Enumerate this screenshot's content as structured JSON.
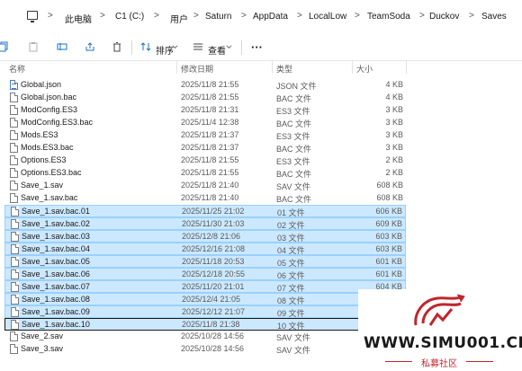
{
  "address": {
    "crumbs": [
      "此电脑",
      "C1 (C:)",
      "用户",
      "Saturn",
      "AppData",
      "LocalLow",
      "TeamSoda",
      "Duckov",
      "Saves"
    ],
    "separator": ">"
  },
  "toolbar": {
    "sort_label": "排序",
    "view_label": "查看",
    "more_label": "···"
  },
  "columns": {
    "name": "名称",
    "modified": "修改日期",
    "type": "类型",
    "size": "大小"
  },
  "files": [
    {
      "name": "Global.json",
      "date": "2025/11/8 21:55",
      "type": "JSON 文件",
      "size": "4 KB",
      "selected": false,
      "icon": "json-file-icon"
    },
    {
      "name": "Global.json.bac",
      "date": "2025/11/8 21:55",
      "type": "BAC 文件",
      "size": "4 KB",
      "selected": false,
      "icon": "file-icon"
    },
    {
      "name": "ModConfig.ES3",
      "date": "2025/11/8 21:31",
      "type": "ES3 文件",
      "size": "3 KB",
      "selected": false,
      "icon": "file-icon"
    },
    {
      "name": "ModConfig.ES3.bac",
      "date": "2025/11/4 12:38",
      "type": "BAC 文件",
      "size": "3 KB",
      "selected": false,
      "icon": "file-icon"
    },
    {
      "name": "Mods.ES3",
      "date": "2025/11/8 21:37",
      "type": "ES3 文件",
      "size": "3 KB",
      "selected": false,
      "icon": "file-icon"
    },
    {
      "name": "Mods.ES3.bac",
      "date": "2025/11/8 21:37",
      "type": "BAC 文件",
      "size": "3 KB",
      "selected": false,
      "icon": "file-icon"
    },
    {
      "name": "Options.ES3",
      "date": "2025/11/8 21:55",
      "type": "ES3 文件",
      "size": "2 KB",
      "selected": false,
      "icon": "file-icon"
    },
    {
      "name": "Options.ES3.bac",
      "date": "2025/11/8 21:55",
      "type": "BAC 文件",
      "size": "2 KB",
      "selected": false,
      "icon": "file-icon"
    },
    {
      "name": "Save_1.sav",
      "date": "2025/11/8 21:40",
      "type": "SAV 文件",
      "size": "608 KB",
      "selected": false,
      "icon": "file-icon"
    },
    {
      "name": "Save_1.sav.bac",
      "date": "2025/11/8 21:40",
      "type": "BAC 文件",
      "size": "608 KB",
      "selected": false,
      "icon": "file-icon"
    },
    {
      "name": "Save_1.sav.bac.01",
      "date": "2025/11/25 21:02",
      "type": "01 文件",
      "size": "606 KB",
      "selected": true,
      "icon": "file-icon"
    },
    {
      "name": "Save_1.sav.bac.02",
      "date": "2025/11/30 21:03",
      "type": "02 文件",
      "size": "609 KB",
      "selected": true,
      "icon": "file-icon"
    },
    {
      "name": "Save_1.sav.bac.03",
      "date": "2025/12/8 21:06",
      "type": "03 文件",
      "size": "603 KB",
      "selected": true,
      "icon": "file-icon"
    },
    {
      "name": "Save_1.sav.bac.04",
      "date": "2025/12/16 21:08",
      "type": "04 文件",
      "size": "603 KB",
      "selected": true,
      "icon": "file-icon"
    },
    {
      "name": "Save_1.sav.bac.05",
      "date": "2025/11/18 20:53",
      "type": "05 文件",
      "size": "601 KB",
      "selected": true,
      "icon": "file-icon"
    },
    {
      "name": "Save_1.sav.bac.06",
      "date": "2025/12/18 20:55",
      "type": "06 文件",
      "size": "601 KB",
      "selected": true,
      "icon": "file-icon"
    },
    {
      "name": "Save_1.sav.bac.07",
      "date": "2025/11/20 21:01",
      "type": "07 文件",
      "size": "604 KB",
      "selected": true,
      "icon": "file-icon"
    },
    {
      "name": "Save_1.sav.bac.08",
      "date": "2025/12/4 21:05",
      "type": "08 文件",
      "size": "",
      "selected": true,
      "icon": "file-icon"
    },
    {
      "name": "Save_1.sav.bac.09",
      "date": "2025/12/12 21:07",
      "type": "09 文件",
      "size": "",
      "selected": true,
      "icon": "file-icon"
    },
    {
      "name": "Save_1.sav.bac.10",
      "date": "2025/11/8 21:38",
      "type": "10 文件",
      "size": "",
      "selected": true,
      "icon": "file-icon"
    },
    {
      "name": "Save_2.sav",
      "date": "2025/10/28 14:56",
      "type": "SAV 文件",
      "size": "",
      "selected": false,
      "icon": "file-icon"
    },
    {
      "name": "Save_3.sav",
      "date": "2025/10/28 14:56",
      "type": "SAV 文件",
      "size": "",
      "selected": false,
      "icon": "file-icon"
    }
  ],
  "watermark": {
    "text": "WWW.SIMU001.CN",
    "subtitle": "私募社区",
    "color": "#c0262c"
  },
  "colors": {
    "selection_bg": "#cce8ff",
    "selection_border": "#99d1ff"
  }
}
